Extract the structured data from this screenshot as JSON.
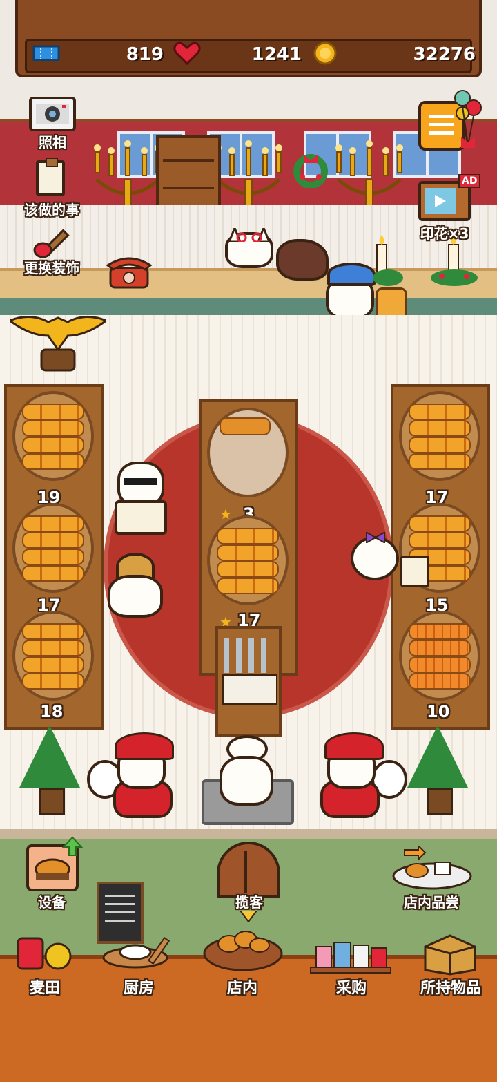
{
  "resources": {
    "tickets": "819",
    "hearts": "1241",
    "coins": "32276"
  },
  "left_menu": {
    "camera": "照相",
    "todo": "该做的事",
    "decor": "更换装饰"
  },
  "tv": {
    "label": "印花×3",
    "badge": "AD"
  },
  "shelves": {
    "left": [
      "19",
      "17",
      "18"
    ],
    "center": [
      "3",
      "17"
    ],
    "right": [
      "17",
      "15",
      "10"
    ]
  },
  "bottom": {
    "equipment": "设备",
    "attract": "揽客",
    "tasting": "店内品尝"
  },
  "nav": [
    "麦田",
    "厨房",
    "店内",
    "采购",
    "所持物品"
  ],
  "colors": {
    "wall": "#b3333a",
    "rug": "#b8352b",
    "bread": "#f2a42a",
    "nav": "#cc6a24"
  }
}
